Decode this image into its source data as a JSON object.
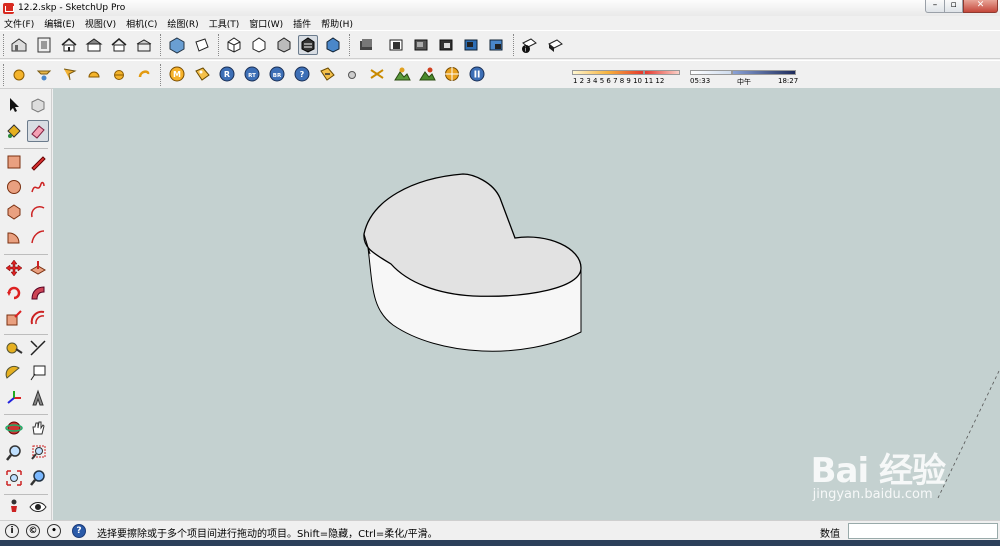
{
  "window": {
    "title": "12.2.skp - SketchUp Pro",
    "min": "–",
    "max": "▫",
    "close": "✕"
  },
  "menu": [
    "文件(F)",
    "编辑(E)",
    "视图(V)",
    "相机(C)",
    "绘图(R)",
    "工具(T)",
    "窗口(W)",
    "插件",
    "帮助(H)"
  ],
  "toolbar": {
    "shadow_months": "1  2  3  4  5  6  7  8  9  10 11 12",
    "time_start": "05:33",
    "time_mid": "中午",
    "time_end": "18:27",
    "ruby_buttons": [
      "M",
      "R",
      "RT",
      "BR",
      "?"
    ]
  },
  "colors": {
    "viewport_bg": "#c4d1d0",
    "shape_top": "#e2e2e2",
    "shape_side": "#f7f7f7"
  },
  "viewport": {
    "watermark_logo": "Bai 经验",
    "watermark_url": "jingyan.baidu.com"
  },
  "status": {
    "hint": "选择要擦除或于多个项目间进行拖动的项目。Shift=隐藏，Ctrl=柔化/平滑。",
    "measurements_label": "数值",
    "measurements_value": ""
  }
}
